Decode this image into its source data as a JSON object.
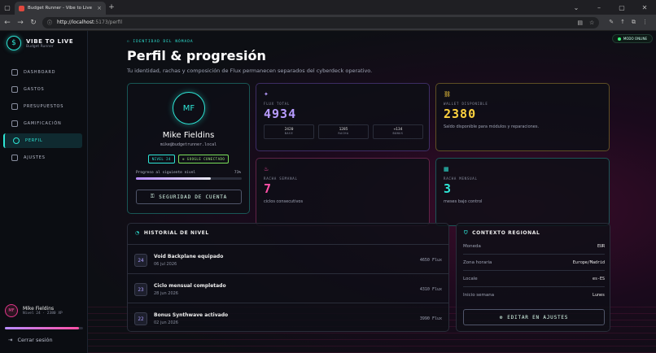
{
  "browser": {
    "tab_title": "Budget Runner - Vibe to Live",
    "url_host": "http://localhost",
    "url_path": ":5173/perfil"
  },
  "sidebar": {
    "brand_title": "VIBE TO LIVE",
    "brand_sub": "Budget Runner",
    "items": [
      {
        "label": "DASHBOARD"
      },
      {
        "label": "GASTOS"
      },
      {
        "label": "PRESUPUESTOS"
      },
      {
        "label": "GAMIFICACIÓN"
      },
      {
        "label": "PERFIL"
      },
      {
        "label": "AJUSTES"
      }
    ],
    "user_initials": "MF",
    "user_name": "Mike Fieldins",
    "user_level": "Nivel 24 · 2380 XP",
    "progress": 0.95,
    "logout": "Cerrar sesión"
  },
  "header": {
    "status_badge": "MODO ONLINE",
    "kicker": "IDENTIDAD DEL NÓMADA",
    "title": "Perfil & progresión",
    "subtitle": "Tu identidad, rachas y composición de Flux permanecen separados del cyberdeck operativo."
  },
  "profile": {
    "initials": "MF",
    "name": "Mike Fieldins",
    "email": "mike@budgetrunner.local",
    "level_chip": "NIVEL 24",
    "google_chip": "GOOGLE CONECTADO",
    "progress_label": "Progreso al siguiente nivel",
    "progress_value": "71%",
    "progress": 0.71,
    "security_button": "SEGURIDAD DE CUENTA"
  },
  "stats": {
    "flux": {
      "label": "FLUX TOTAL",
      "value": "4934",
      "mini": [
        {
          "v": "2420",
          "k": "BASE"
        },
        {
          "v": "1285",
          "k": "RACHA"
        },
        {
          "v": "+134",
          "k": "BONUS"
        }
      ],
      "color": "#b89cff"
    },
    "wallet": {
      "label": "WALLET DISPONIBLE",
      "value": "2380",
      "desc": "Saldo disponible para módulos y reparaciones.",
      "color": "#ffd23f"
    },
    "weekly": {
      "label": "RACHA SEMANAL",
      "value": "7",
      "desc": "ciclos consecutivos",
      "color": "#ff4fa5"
    },
    "monthly": {
      "label": "RACHA MENSUAL",
      "value": "3",
      "desc": "meses bajo control",
      "color": "#2ee6d6"
    }
  },
  "history": {
    "title": "HISTORIAL DE NIVEL",
    "rows": [
      {
        "level": "24",
        "title": "Void Backplane equipado",
        "date": "06 jul 2026",
        "xp": "4650 Flux"
      },
      {
        "level": "23",
        "title": "Ciclo mensual completado",
        "date": "28 jun 2026",
        "xp": "4310 Flux"
      },
      {
        "level": "22",
        "title": "Bonus Synthwave activado",
        "date": "02 jun 2026",
        "xp": "3990 Flux"
      }
    ]
  },
  "regional": {
    "title": "CONTEXTO REGIONAL",
    "rows": [
      {
        "k": "Moneda",
        "v": "EUR"
      },
      {
        "k": "Zona horaria",
        "v": "Europe/Madrid"
      },
      {
        "k": "Locale",
        "v": "es-ES"
      },
      {
        "k": "Inicio semana",
        "v": "Lunes"
      }
    ],
    "edit_button": "EDITAR EN AJUSTES"
  }
}
